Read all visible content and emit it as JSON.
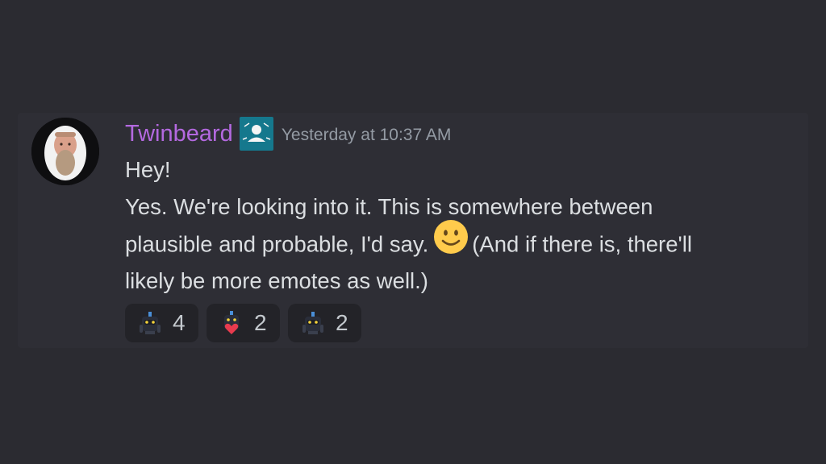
{
  "message": {
    "author": "Twinbeard",
    "author_color": "#b469e0",
    "role_badge_icon": "person-badge-icon",
    "timestamp": "Yesterday at 10:37 AM",
    "lines": {
      "l1": "Hey!",
      "l2": "Yes. We're looking into it. This is somewhere between",
      "l3a": "plausible and probable, I'd say.",
      "l3b": "(And if there is, there'll",
      "l4": "likely be more emotes as well.)"
    },
    "inline_emoji": "slightly-smiling-face"
  },
  "reactions": [
    {
      "emoji": "robot-dark-emote",
      "count": "4"
    },
    {
      "emoji": "robot-heart-emote",
      "count": "2"
    },
    {
      "emoji": "robot-dark-emote",
      "count": "2"
    }
  ],
  "colors": {
    "background": "#2b2b31",
    "message_hover": "#2e2e35",
    "text": "#dbdee1",
    "timestamp": "#949ba4",
    "reaction_bg": "#232328",
    "badge": "#15788d"
  }
}
